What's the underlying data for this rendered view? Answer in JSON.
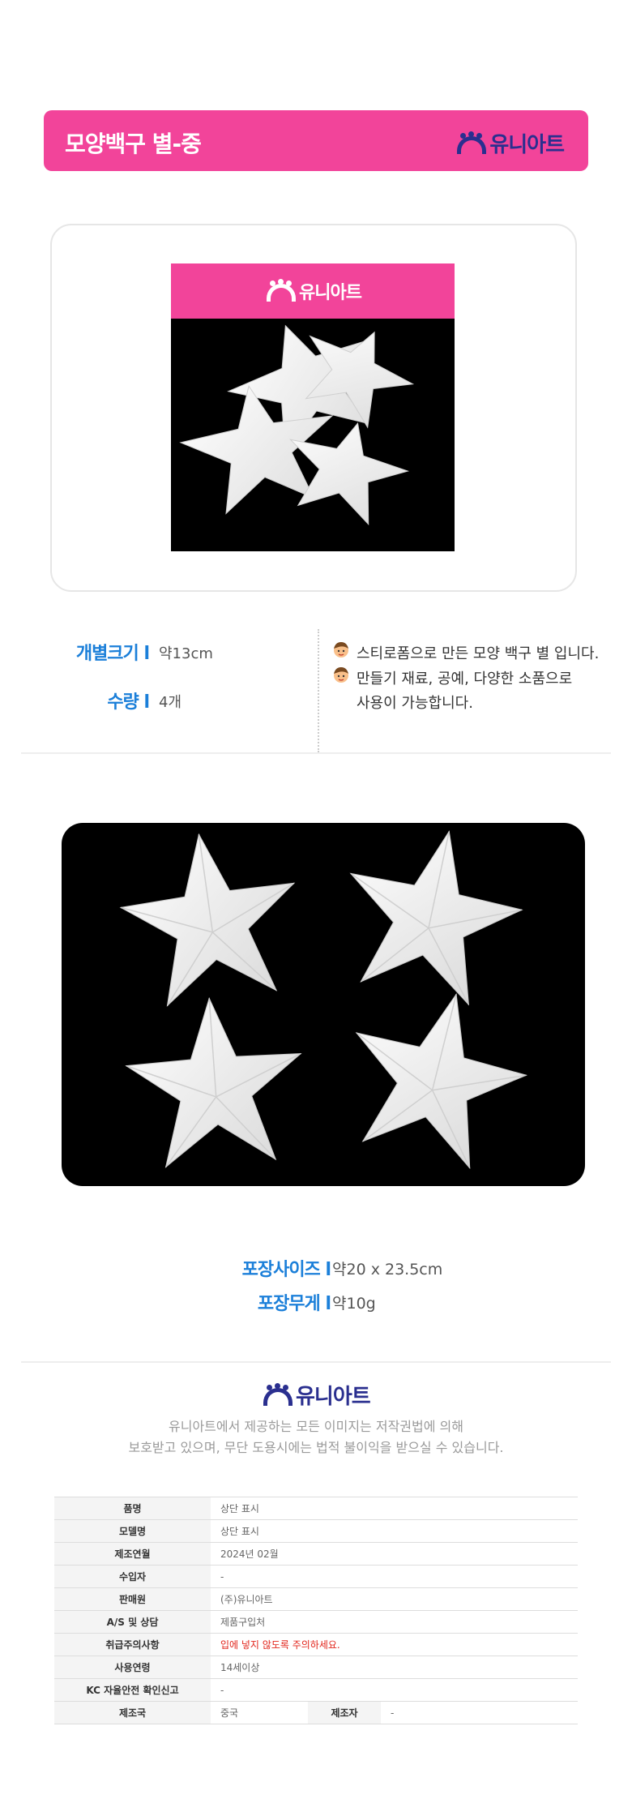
{
  "header": {
    "title": "모양백구 별-중",
    "brand": "유니아트",
    "bg_color": "#f2449a"
  },
  "package": {
    "brand": "유니아트"
  },
  "spec": {
    "size_label": "개별크기 l",
    "size_value": "약13cm",
    "qty_label": "수량 l",
    "qty_value": "4개",
    "icon": "kid-face-icon",
    "desc": [
      "스티로폼으로 만든 모양 백구 별 입니다.",
      "만들기 재료, 공예, 다양한 소품으로",
      "사용이 가능합니다."
    ]
  },
  "pack": {
    "size_label": "포장사이즈 l",
    "size_value": "약20 x 23.5cm",
    "weight_label": "포장무게 l",
    "weight_value": "약10g"
  },
  "copyright": {
    "brand": "유니아트",
    "line1": "유니아트에서 제공하는 모든 이미지는 저작권법에 의해",
    "line2": "보호받고 있으며, 무단 도용시에는 법적 불이익을 받으실 수 있습니다."
  },
  "info_table": {
    "rows": [
      {
        "key": "품명",
        "value": "상단 표시"
      },
      {
        "key": "모델명",
        "value": "상단 표시"
      },
      {
        "key": "제조연월",
        "value": "2024년 02월"
      },
      {
        "key": "수입자",
        "value": "-"
      },
      {
        "key": "판매원",
        "value": "(주)유니아트"
      },
      {
        "key": "A/S 및 상담",
        "value": "제품구입처"
      },
      {
        "key": "취급주의사항",
        "value": "입에 넣지 않도록 주의하세요."
      },
      {
        "key": "사용연령",
        "value": "14세이상"
      },
      {
        "key": "KC 자율안전 확인신고",
        "value": "-"
      }
    ],
    "last_row": {
      "key1": "제조국",
      "value1": "중국",
      "key2": "제조자",
      "value2": "-"
    },
    "warn_color": "#e2261c"
  }
}
